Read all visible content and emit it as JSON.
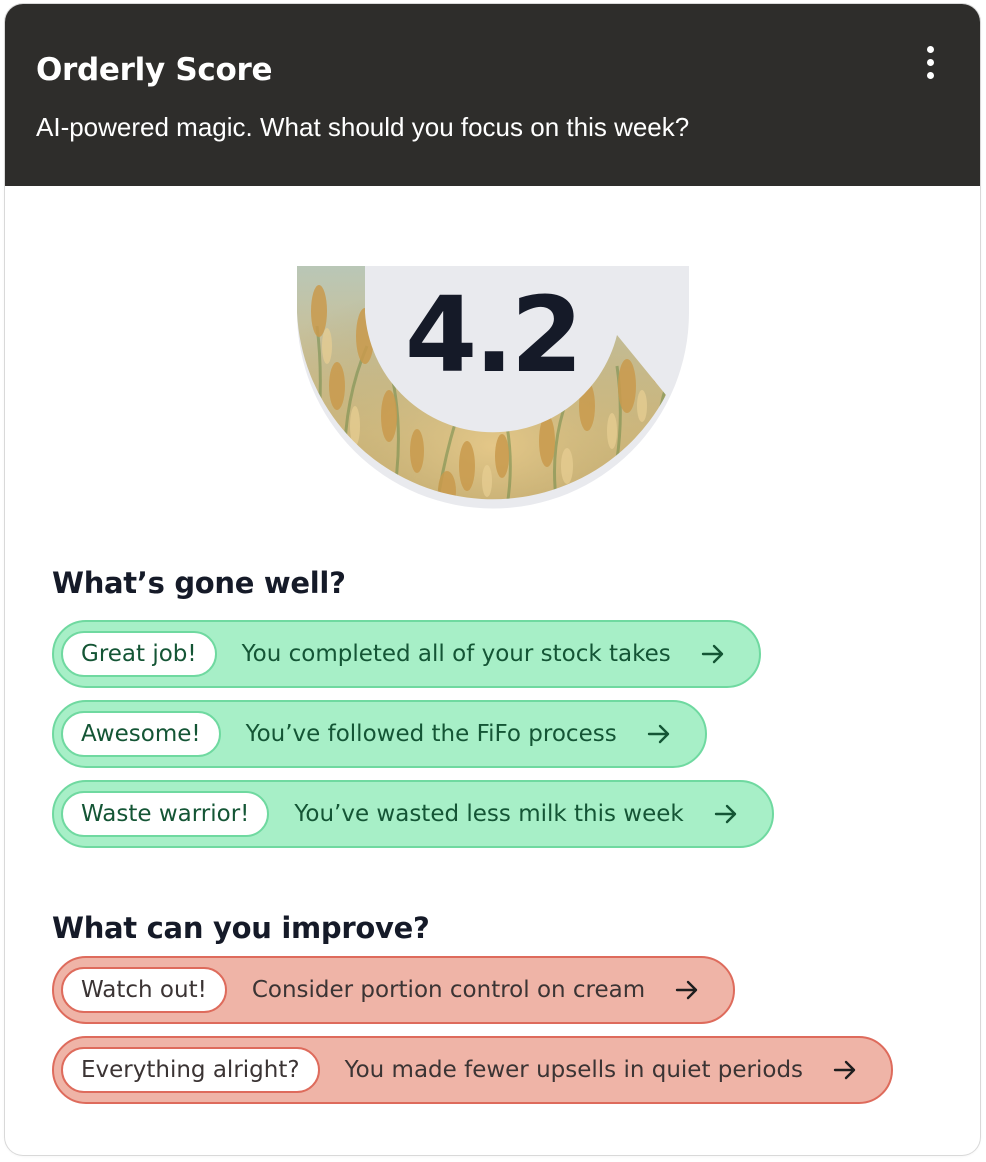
{
  "header": {
    "title": "Orderly Score",
    "subtitle": "AI-powered magic. What should you focus on this week?"
  },
  "score": {
    "value": "4.2",
    "gauge_fraction": 0.84
  },
  "colors": {
    "header_bg": "#2e2d2b",
    "good_fill": "#a7efc7",
    "good_border": "#6fd9a0",
    "good_text": "#145535",
    "bad_fill": "#efb4a7",
    "bad_border": "#de6b5c",
    "gauge_track": "#e9eaee"
  },
  "gone_well": {
    "heading": "What’s gone well?",
    "items": [
      {
        "tag": "Great job!",
        "message": "You completed all of your stock takes",
        "icon": "arrow-right-icon"
      },
      {
        "tag": "Awesome!",
        "message": "You’ve followed the FiFo process",
        "icon": "arrow-right-icon"
      },
      {
        "tag": "Waste warrior!",
        "message": "You’ve wasted less milk this week",
        "icon": "arrow-right-icon"
      }
    ]
  },
  "improve": {
    "heading": "What can you improve?",
    "items": [
      {
        "tag": "Watch out!",
        "message": "Consider portion control on cream",
        "icon": "arrow-right-icon"
      },
      {
        "tag": "Everything alright?",
        "message": "You made fewer upsells in quiet periods",
        "icon": "arrow-right-icon"
      }
    ]
  }
}
